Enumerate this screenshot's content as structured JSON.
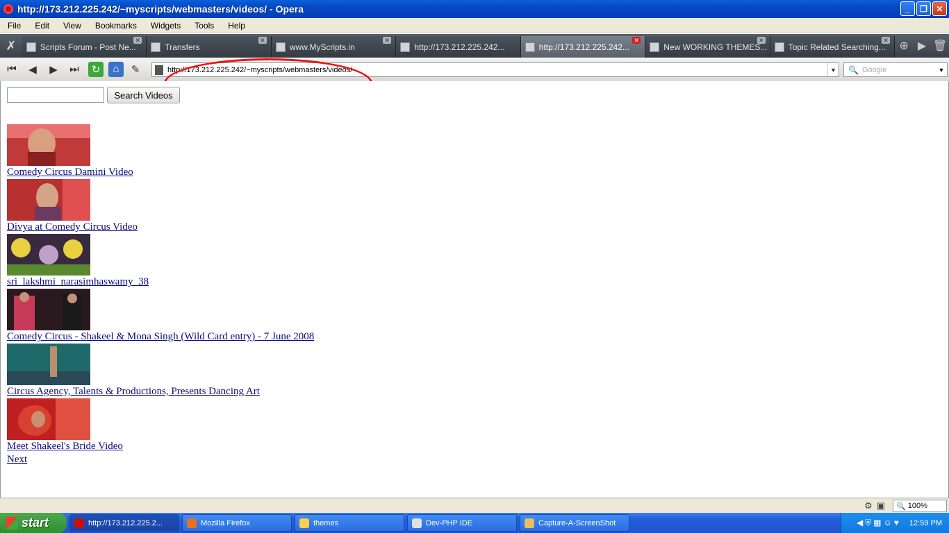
{
  "window": {
    "title": "http://173.212.225.242/~myscripts/webmasters/videos/ - Opera"
  },
  "menu": [
    "File",
    "Edit",
    "View",
    "Bookmarks",
    "Widgets",
    "Tools",
    "Help"
  ],
  "tabs": [
    {
      "label": "Scripts Forum - Post Ne...",
      "active": false
    },
    {
      "label": "Transfers",
      "active": false
    },
    {
      "label": "www.MyScripts.in",
      "active": false
    },
    {
      "label": "http://173.212.225.242...",
      "active": false
    },
    {
      "label": "http://173.212.225.242...",
      "active": true
    },
    {
      "label": "New WORKING THEMES...",
      "active": false
    },
    {
      "label": "Topic Related Searching...",
      "active": false
    }
  ],
  "address": {
    "url": "http://173.212.225.242/~myscripts/webmasters/videos/"
  },
  "search": {
    "placeholder": "Google"
  },
  "page": {
    "search_value": "",
    "search_button": "Search Videos",
    "videos": [
      {
        "title": "Comedy Circus Damini Video"
      },
      {
        "title": "Divya at Comedy Circus Video"
      },
      {
        "title": "sri_lakshmi_narasimhaswamy_38"
      },
      {
        "title": "Comedy Circus - Shakeel & Mona Singh (Wild Card entry) - 7 June 2008"
      },
      {
        "title": "Circus Agency, Talents & Productions, Presents Dancing Art"
      },
      {
        "title": "Meet Shakeel's Bride Video"
      }
    ],
    "next_label": "Next"
  },
  "status": {
    "zoom": "100%"
  },
  "taskbar": {
    "start": "start",
    "items": [
      {
        "label": "http://173.212.225.2...",
        "active": true
      },
      {
        "label": "Mozilla Firefox",
        "active": false
      },
      {
        "label": "themes",
        "active": false
      },
      {
        "label": "Dev-PHP IDE",
        "active": false
      },
      {
        "label": "Capture-A-ScreenShot",
        "active": false
      }
    ],
    "clock": "12:59 PM"
  }
}
